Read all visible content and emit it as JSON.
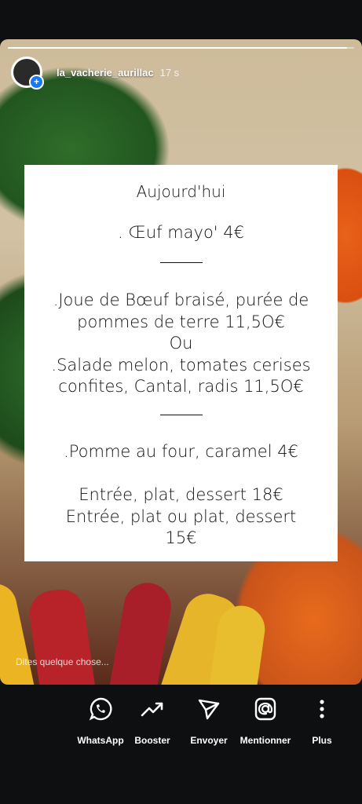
{
  "story": {
    "username": "la_vacherie_aurillac",
    "time": "17 s",
    "progress": 0.98
  },
  "card": {
    "title": "Aujourd'hui",
    "lines": [
      ". Œuf mayo' 4€",
      ".Joue de Bœuf braisé, purée de",
      "pommes de terre 11,5O€",
      "Ou",
      ".Salade melon, tomates cerises",
      "confites, Cantal, radis  11,5O€",
      ".Pomme au four, caramel 4€",
      "Entrée, plat, dessert 18€",
      "Entrée, plat ou plat, dessert",
      "15€"
    ]
  },
  "reply_placeholder": "Dites quelque chose...",
  "actions": [
    {
      "label": "WhatsApp",
      "icon": "whatsapp-icon"
    },
    {
      "label": "Booster",
      "icon": "trending-up-icon"
    },
    {
      "label": "Envoyer",
      "icon": "send-icon"
    },
    {
      "label": "Mentionner",
      "icon": "at-icon"
    },
    {
      "label": "Plus",
      "icon": "more-vertical-icon"
    }
  ]
}
